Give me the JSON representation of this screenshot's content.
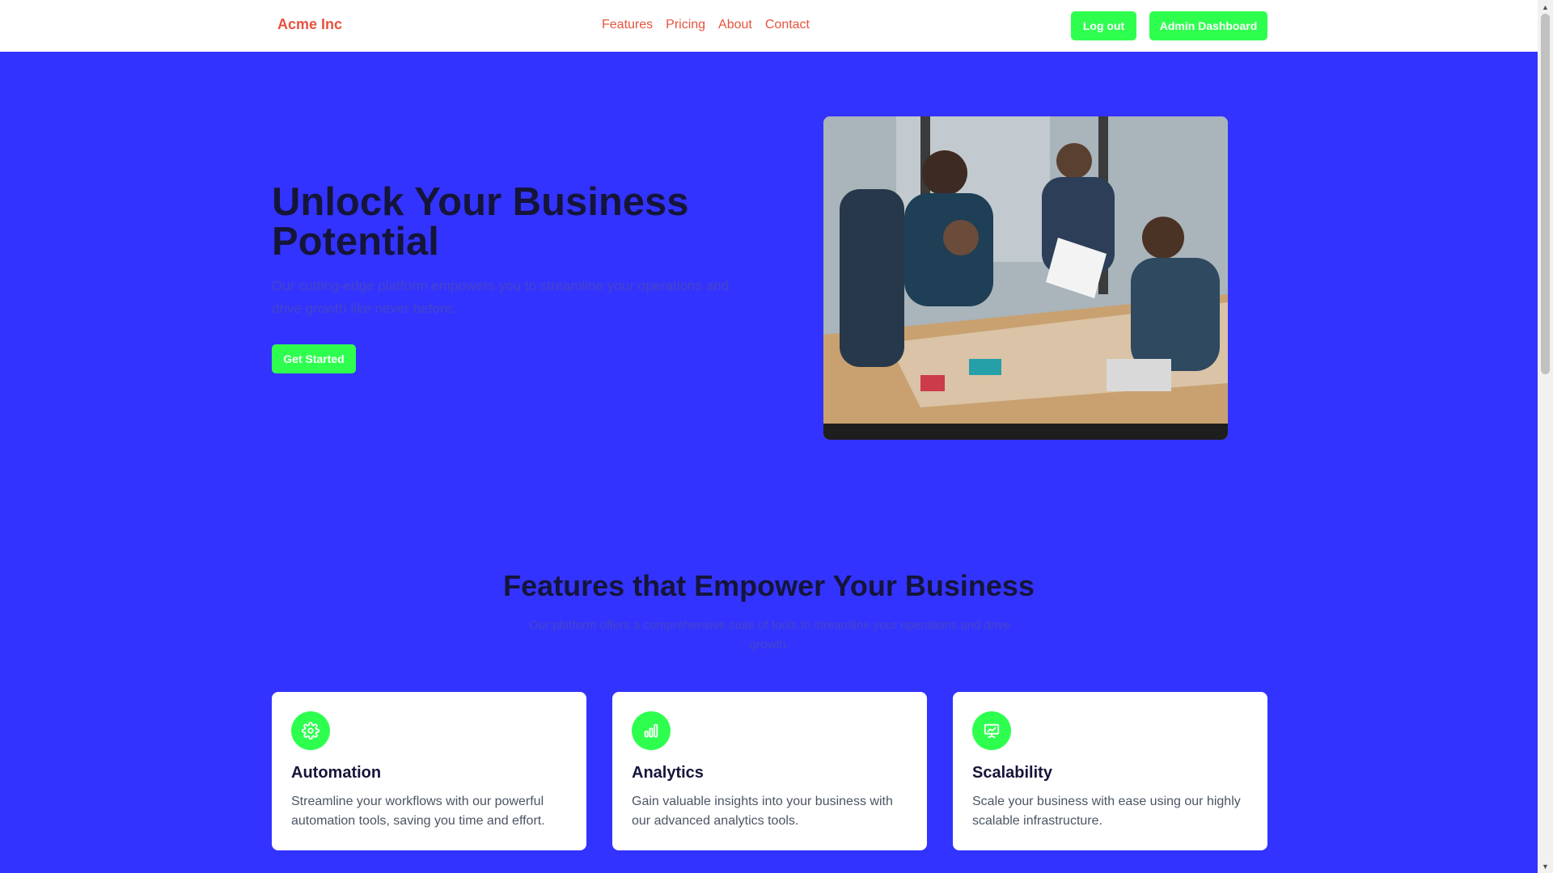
{
  "header": {
    "brand": "Acme Inc",
    "nav": [
      "Features",
      "Pricing",
      "About",
      "Contact"
    ],
    "logout_label": "Log out",
    "admin_label": "Admin Dashboard"
  },
  "hero": {
    "title_line1": "Unlock Your Business",
    "title_line2": "Potential",
    "subtitle": "Our cutting-edge platform empowers you to streamline your operations and drive growth like never before.",
    "cta_label": "Get Started",
    "image_alt": "team-meeting-photo"
  },
  "features": {
    "title": "Features that Empower Your Business",
    "subtitle": "Our platform offers a comprehensive suite of tools to streamline your operations and drive growth.",
    "cards": [
      {
        "title": "Automation",
        "text": "Streamline your workflows with our powerful automation tools, saving you time and effort.",
        "icon": "gear-icon"
      },
      {
        "title": "Analytics",
        "text": "Gain valuable insights into your business with our advanced analytics tools.",
        "icon": "bar-chart-icon"
      },
      {
        "title": "Scalability",
        "text": "Scale your business with ease using our highly scalable infrastructure.",
        "icon": "presentation-chart-icon"
      }
    ]
  },
  "colors": {
    "background": "#3333ff",
    "accent": "#2eff4f",
    "brand": "#e5533d",
    "heading": "#15153a"
  }
}
